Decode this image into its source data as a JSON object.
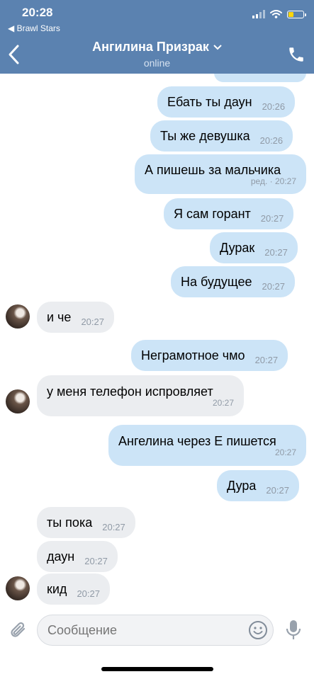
{
  "status_bar": {
    "time": "20:28",
    "back_app": "◀ Brawl Stars"
  },
  "header": {
    "contact_name": "Ангилина Призрак",
    "status": "online"
  },
  "messages": [
    {
      "side": "out",
      "text": "Ебать ты даун",
      "time": "20:26"
    },
    {
      "side": "out",
      "text": "Ты же девушка",
      "time": "20:26"
    },
    {
      "side": "out",
      "text": "А пишешь за мальчика",
      "time": "ред. · 20:27"
    },
    {
      "side": "out",
      "text": "Я сам горант",
      "time": "20:27"
    },
    {
      "side": "out",
      "text": "Дурак",
      "time": "20:27"
    },
    {
      "side": "out",
      "text": "На будущее",
      "time": "20:27"
    },
    {
      "side": "in",
      "text": "и че",
      "time": "20:27"
    },
    {
      "side": "out",
      "text": "Неграмотное чмо",
      "time": "20:27"
    },
    {
      "side": "in",
      "text": "у меня телефон испровляет",
      "time": "20:27"
    },
    {
      "side": "out",
      "text": "Ангелина через Е пишется",
      "time": "20:27"
    },
    {
      "side": "out",
      "text": "Дура",
      "time": "20:27"
    },
    {
      "side": "in",
      "text": "ты пока",
      "time": "20:27"
    },
    {
      "side": "in",
      "text": "даун",
      "time": "20:27"
    },
    {
      "side": "in",
      "text": "кид",
      "time": "20:27"
    }
  ],
  "composer": {
    "placeholder": "Сообщение"
  },
  "colors": {
    "header": "#5b82b0",
    "outgoing": "#cce4f7",
    "incoming": "#ebedf0"
  }
}
